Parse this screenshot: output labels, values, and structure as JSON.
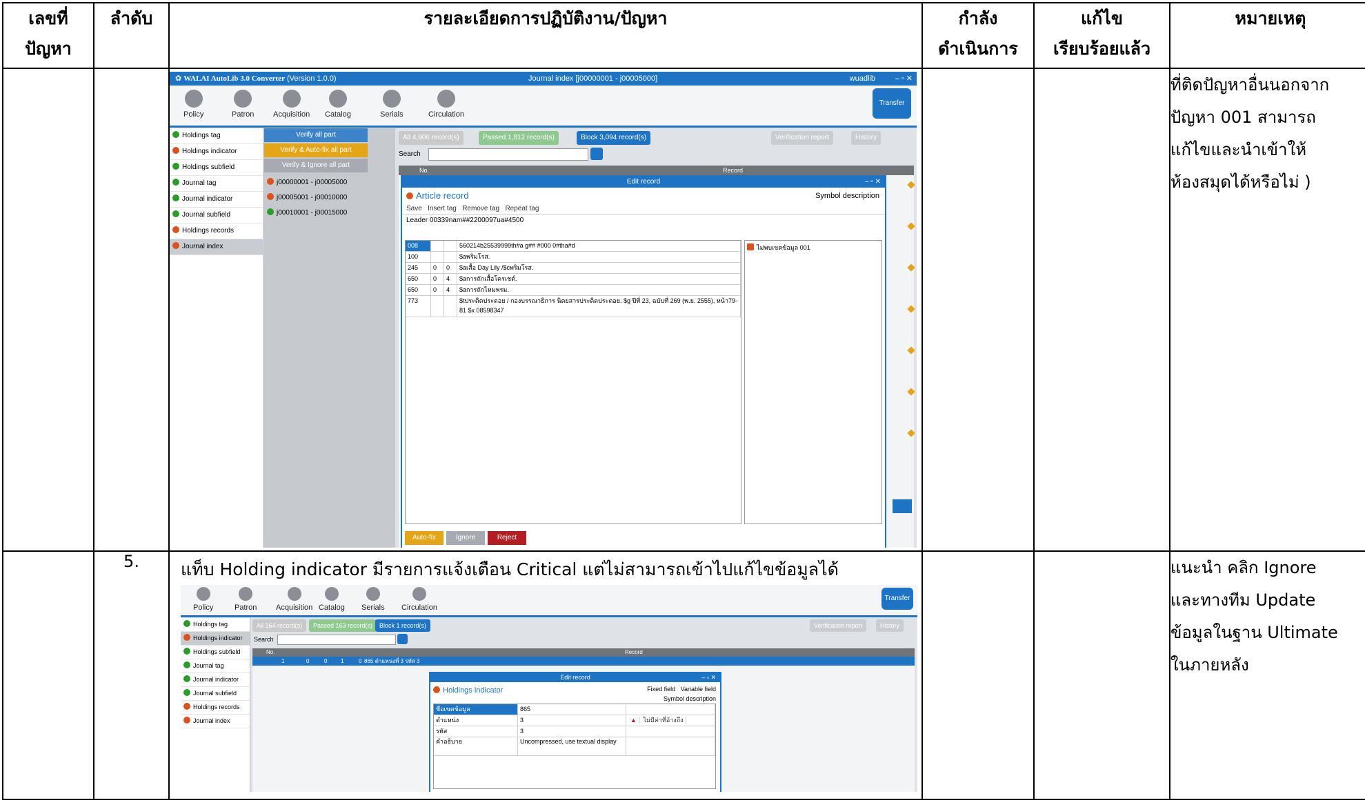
{
  "headers": {
    "issue_no": "เลขที่ปัญหา",
    "seq": "ลำดับ",
    "detail": "รายละเอียดการปฏิบัติงาน/ปัญหา",
    "in_progress": "กำลังดำเนินการ",
    "fixed": "แก้ไขเรียบร้อยแล้ว",
    "remark": "หมายเหตุ"
  },
  "headers_split": {
    "issue_no_a": "เลขที่",
    "issue_no_b": "ปัญหา",
    "in_progress_a": "กำลัง",
    "in_progress_b": "ดำเนินการ",
    "fixed_a": "แก้ไข",
    "fixed_b": "เรียบร้อยแล้ว"
  },
  "row1": {
    "remark_lines": [
      "ที่ติดปัญหาอื่นนอกจาก",
      "ปัญหา 001 สามารถ",
      "แก้ไขและนำเข้าให้",
      "ห้องสมุดได้หรือไม่ )"
    ],
    "app": {
      "title": "WALAI AutoLib 3.0 Converter",
      "version": "(Version 1.0.0)",
      "window": "Journal index [j00000001 - j00005000]",
      "user": "wuadlib",
      "modules": [
        "Policy",
        "Patron",
        "Acquisition",
        "Catalog",
        "Serials",
        "Circulation"
      ],
      "transfer": "Transfer",
      "side": [
        {
          "label": "Holdings tag",
          "status": "ok"
        },
        {
          "label": "Holdings indicator",
          "status": "bad"
        },
        {
          "label": "Holdings subfield",
          "status": "ok"
        },
        {
          "label": "Journal tag",
          "status": "ok"
        },
        {
          "label": "Journal indicator",
          "status": "ok"
        },
        {
          "label": "Journal subfield",
          "status": "ok"
        },
        {
          "label": "Holdings records",
          "status": "bad"
        },
        {
          "label": "Journal index",
          "status": "bad"
        }
      ],
      "verify": [
        "Verify all part",
        "Verify & Auto-fix all part",
        "Verify & Ignore all part"
      ],
      "ranges": [
        {
          "label": "j00000001 - j00005000",
          "status": "bad"
        },
        {
          "label": "j00005001 - j00010000",
          "status": "bad"
        },
        {
          "label": "j00010001 - j00015000",
          "status": "ok"
        }
      ],
      "filters": {
        "all": "All 4,906 record(s)",
        "passed": "Passed 1,812 record(s)",
        "block": "Block 3,094 record(s)"
      },
      "verification_report": "Verification report",
      "history": "History",
      "search": "Search",
      "cols": {
        "no": "No.",
        "record": "Record"
      },
      "edit": {
        "title": "Edit record",
        "heading": "Article record",
        "symbol": "Symbol description",
        "save": "Save",
        "insert": "Insert tag",
        "remove": "Remove tag",
        "repeat": "Repeat tag",
        "leader": "Leader  00339nam##2200097ua#4500",
        "rows": [
          [
            "008",
            "",
            "",
            "560214b25539999th#a  g##  #000 0#tha#d"
          ],
          [
            "100",
            "",
            "",
            "$aพริมโรส."
          ],
          [
            "245",
            "0",
            "0",
            "$aเสื้อ Day Lily /$cพริมโรส."
          ],
          [
            "650",
            "0",
            "4",
            "$aการถักเสื้อโครเชต์."
          ],
          [
            "650",
            "0",
            "4",
            "$aการถักไหมพรม."
          ],
          [
            "773",
            "",
            "",
            "$tประดิดประดอย / กองบรรณาธิการ นิตยสารประดิดประดอย. $g ปีที่ 23, ฉบับที่ 269 (พ.ย. 2555), หน้า79-81 $x 08598347"
          ]
        ],
        "error": "ไม่พบเขตข้อมูล 001",
        "autofix": "Auto-fix",
        "ignore": "Ignore",
        "reject": "Reject"
      }
    }
  },
  "row2": {
    "seq": "5.",
    "desc": "แท็บ Holding indicator มีรายการแจ้งเตือน Critical แต่ไม่สามารถเข้าไปแก้ไขข้อมูลได้",
    "remark_lines": [
      "แนะนำ คลิก Ignore",
      "และทางทีม Update",
      "ข้อมูลในฐาน Ultimate",
      "ในภายหลัง"
    ],
    "app": {
      "filters": {
        "all": "All 164 record(s)",
        "passed": "Passed 163 record(s)",
        "block": "Block 1 record(s)"
      },
      "row": {
        "no": "1",
        "c1": "0",
        "c2": "0",
        "c3": "1",
        "c4": "0",
        "rec": "865 ตำแหน่งที่ 3 รหัส 3"
      },
      "edit": {
        "title": "Edit record",
        "heading": "Holdings indicator",
        "fixed": "Fixed field",
        "variable": "Variable field",
        "symbol": "Symbol description",
        "rows": [
          [
            "ชื่อเขตข้อมูล",
            "865",
            ""
          ],
          [
            "ตำแหน่ง",
            "3",
            "ไม่มีค่าที่อ้างถึง"
          ],
          [
            "รหัส",
            "3",
            ""
          ],
          [
            "คำอธิบาย",
            "Uncompressed, use textual display",
            ""
          ]
        ]
      }
    }
  }
}
